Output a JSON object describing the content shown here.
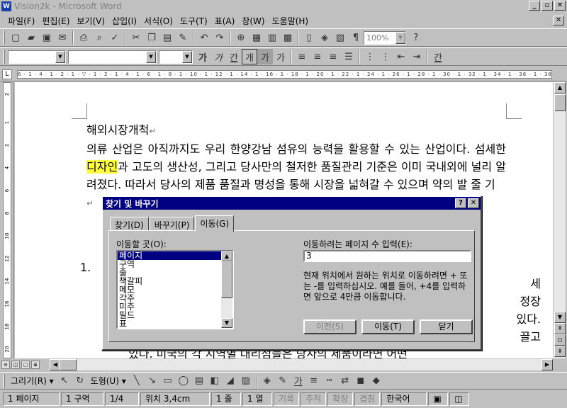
{
  "window": {
    "title": "Vision2k - Microsoft Word",
    "icon": "word-icon",
    "controls": [
      "_",
      "▫",
      "✕"
    ],
    "doc_close": "✕"
  },
  "menu": [
    "파일(F)",
    "편집(E)",
    "보기(V)",
    "삽입(I)",
    "서식(O)",
    "도구(T)",
    "표(A)",
    "창(W)",
    "도움말(H)"
  ],
  "toolbar": {
    "zoom": "100%",
    "help": "?",
    "style_font": "",
    "font_name": "",
    "font_size": "",
    "font_buttons": [
      "가",
      "가",
      "간",
      "개",
      "가",
      "가"
    ],
    "font_color_btn": "간"
  },
  "ruler": {
    "corner": "L",
    "marks": "6 · 1 · 4 · 1 · 2 · 1 · ▽ · 1 · 2 · 1 · 4 · 1 · 6 · 1 · 8 · 1 · 10 · 1 · 12 · 1 · 14 · 1 · 16 · 1 · 18 · 1 · 20 · 1 · 22 · 1 · 24 · 1 · 26 · 1 · 28 · 1 · 30 · 1 · 32 · 1 · 34 · 1 · 36 · 1 · 38 · 1 · 40",
    "vmarks": [
      "2",
      "1",
      "2",
      "4",
      "6",
      "8",
      "10",
      "12",
      "14",
      "16",
      "18",
      "20"
    ]
  },
  "document": {
    "heading": "해외시장개척",
    "para_before": "의류 산업은 아직까지도 우리 한양강남 섬유의 능력을 활용할 수 있는 산업이다. 섬세한 ",
    "highlight": "디자인",
    "para_after": "과 고도의 생산성, 그리고 당사만의 철저한 품질관리 기준은 이미 국내외에 널리 알려졌다. 따라서 당사의 제품 품질과 명성을 통해 시장을 넓혀갈 수 있으며 약의 발 줄 기",
    "list_num": "1.",
    "right_fragments": [
      "세",
      "정장",
      "있다.",
      "끌고"
    ],
    "lower_line": "있다. 미국의 각 지역별 대리점들은 당사의 제품이라면 어떤",
    "pilcrow": "↵"
  },
  "dialog": {
    "title": "찾기 및 바꾸기",
    "help_btn": "?",
    "close_btn": "✕",
    "tabs": [
      "찾기(D)",
      "바꾸기(P)",
      "이동(G)"
    ],
    "goto_label": "이동할 곳(O):",
    "goto_items": [
      "페이지",
      "구역",
      "줄",
      "책갈피",
      "메모",
      "각주",
      "미주",
      "필드",
      "표"
    ],
    "page_label": "이동하려는 페이지 수 입력(E):",
    "page_value": "3",
    "help_text": "현재 위치에서 원하는 위치로 이동하려면 + 또는 -를 입력하십시오. 예를 들어, +4를 입력하면 앞으로 4만큼 이동합니다.",
    "buttons": {
      "prev": "이전(S)",
      "next": "이동(T)",
      "close": "닫기"
    }
  },
  "drawbar": {
    "draw": "그리기(R) ▾",
    "autoshape": "도형(U) ▾"
  },
  "status": {
    "page": "1 페이지",
    "section": "1 구역",
    "pages": "1/4",
    "position": "위치 3,4cm",
    "line": "1 줄",
    "col": "1 열",
    "rec": "기록",
    "trk": "추적",
    "ext": "확장",
    "ovr": "겹침",
    "lang": "한국어"
  }
}
